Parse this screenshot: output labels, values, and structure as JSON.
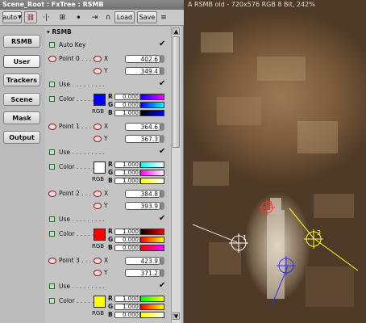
{
  "window": {
    "title": "Scene_Root : FxTree : RSMB"
  },
  "toolbar": {
    "auto_label": "auto",
    "load_label": "Load",
    "save_label": "Save"
  },
  "sidebar": {
    "items": [
      {
        "label": "RSMB"
      },
      {
        "label": "User"
      },
      {
        "label": "Trackers"
      },
      {
        "label": "Scene"
      },
      {
        "label": "Mask"
      },
      {
        "label": "Output"
      }
    ],
    "selected": "User"
  },
  "node": {
    "header": "RSMB"
  },
  "params": {
    "auto_key": "Auto Key",
    "p0": {
      "label": "Point 0",
      "x": "402.6",
      "y": "349.4"
    },
    "p1": {
      "label": "Point 1",
      "x": "364.6",
      "y": "367.3"
    },
    "p2": {
      "label": "Point 2",
      "x": "384.8",
      "y": "393.9"
    },
    "p3": {
      "label": "Point 3",
      "x": "423.9",
      "y": "371.2"
    },
    "use": "Use",
    "color": "Color",
    "x_label": "X",
    "y_label": "Y",
    "rgb_label": "RGB",
    "r": "R",
    "g": "G",
    "b": "B",
    "c0": {
      "r": "0.000",
      "g": "0.000",
      "b": "1.000",
      "hex": "#0000ff"
    },
    "c1": {
      "r": "1.000",
      "g": "1.000",
      "b": "1.000",
      "hex": "#ffffff"
    },
    "c2": {
      "r": "1.000",
      "g": "0.000",
      "b": "0.000",
      "hex": "#ff0000"
    },
    "c3": {
      "r": "1.000",
      "g": "1.000",
      "b": "0.000",
      "hex": "#ffff00"
    }
  },
  "viewer": {
    "info": "A RSMB  old - 720x576 RGB 8 Bit, 242%",
    "markers": [
      {
        "label": "1",
        "color": "#ffffff"
      },
      {
        "label": "2",
        "color": "#ff3030"
      },
      {
        "label": "3",
        "color": "#ffff20"
      },
      {
        "label": "",
        "color": "#3030ff"
      }
    ]
  }
}
